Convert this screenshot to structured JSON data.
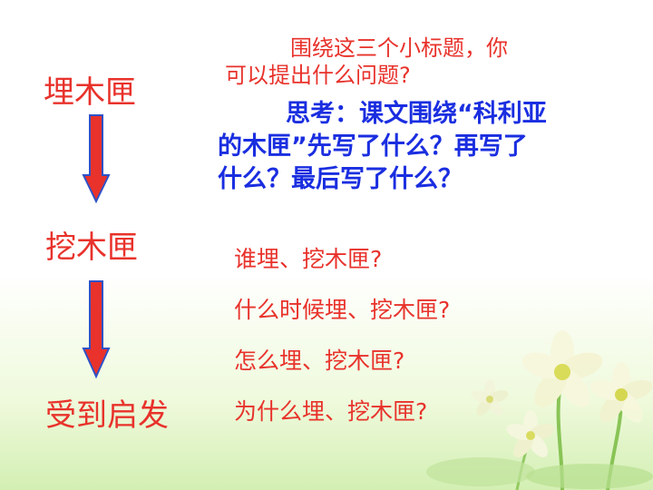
{
  "stages": {
    "first": "埋木匣",
    "second": "挖木匣",
    "third": "受到启发"
  },
  "intro": {
    "line1": "围绕这三个小标题，你",
    "line2": "可以提出什么问题?"
  },
  "think": {
    "line1": "思考：课文围绕“科利亚",
    "line2": "的木匣”先写了什么？再写了",
    "line3": "什么？最后写了什么？"
  },
  "questions": [
    "谁埋、挖木匣?",
    "什么时候埋、挖木匣?",
    "怎么埋、挖木匣?",
    "为什么埋、挖木匣?"
  ],
  "icons": [
    "arrow-down-icon",
    "flower-icon"
  ],
  "colors": {
    "red_text": "#e8322b",
    "blue_text": "#1a2ee0",
    "arrow_fill": "#e8322b",
    "arrow_stroke": "#2d52c8"
  }
}
